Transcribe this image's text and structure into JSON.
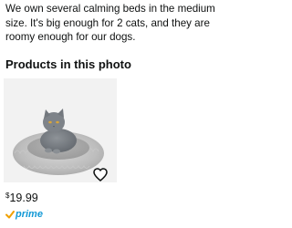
{
  "review": {
    "text": "We own several calming beds in the medium size.  It's big enough for 2 cats, and they are roomy enough for our dogs."
  },
  "products_section": {
    "title": "Products in this photo"
  },
  "products": [
    {
      "image_alt": "grey cat on round plush calming bed",
      "price_symbol": "$",
      "price_value": "19.99",
      "prime_label": "prime",
      "wishlist_icon": "heart-icon"
    }
  ],
  "colors": {
    "prime_blue": "#1399d6",
    "text": "#0f1111"
  }
}
